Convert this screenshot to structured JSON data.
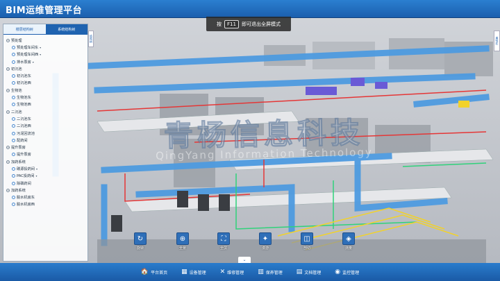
{
  "header": {
    "title": "BIM运维管理平台"
  },
  "hint": {
    "prefix": "按",
    "key": "F11",
    "suffix": "即可退出全屏模式"
  },
  "left_panel": {
    "tabs": [
      {
        "label": "楼层结构树",
        "active": false
      },
      {
        "label": "系统结构树",
        "active": true
      }
    ],
    "tree": [
      {
        "label": "预处理",
        "level": 0
      },
      {
        "label": "预处理车间东",
        "level": 1,
        "has_caret": true
      },
      {
        "label": "预处理车间西",
        "level": 1,
        "has_caret": true
      },
      {
        "label": "排水泵房",
        "level": 1,
        "has_caret": true
      },
      {
        "label": "初沉池",
        "level": 0
      },
      {
        "label": "初沉池东",
        "level": 1,
        "has_caret": false
      },
      {
        "label": "初沉池西",
        "level": 1,
        "has_caret": false
      },
      {
        "label": "生物池",
        "level": 0
      },
      {
        "label": "生物池东",
        "level": 1,
        "has_caret": false
      },
      {
        "label": "生物池西",
        "level": 1,
        "has_caret": false
      },
      {
        "label": "二沉池",
        "level": 0
      },
      {
        "label": "二沉池东",
        "level": 1,
        "has_caret": false
      },
      {
        "label": "二沉池西",
        "level": 1,
        "has_caret": false
      },
      {
        "label": "污泥回流池",
        "level": 1,
        "has_caret": false
      },
      {
        "label": "配药间",
        "level": 1,
        "has_caret": false
      },
      {
        "label": "提升泵房",
        "level": 0
      },
      {
        "label": "提升泵房",
        "level": 1,
        "has_caret": false
      },
      {
        "label": "加药系统",
        "level": 0
      },
      {
        "label": "碳源投药间",
        "level": 1,
        "has_caret": true
      },
      {
        "label": "PAC投药间",
        "level": 1,
        "has_caret": true
      },
      {
        "label": "除磷药间",
        "level": 1,
        "has_caret": false
      },
      {
        "label": "加药系统",
        "level": 0
      },
      {
        "label": "脱水机房东",
        "level": 1,
        "has_caret": false
      },
      {
        "label": "脱水机房西",
        "level": 1,
        "has_caret": false
      }
    ],
    "handle_label": "结构树"
  },
  "right_handle_label": "属性栏",
  "watermark": {
    "cn": "青杨信息科技",
    "en": "QingYang Information Technology"
  },
  "tools": [
    {
      "label": "旋转",
      "icon": "↻"
    },
    {
      "label": "全景",
      "icon": "⊕"
    },
    {
      "label": "全屏",
      "icon": "⛶"
    },
    {
      "label": "漫游",
      "icon": "✦"
    },
    {
      "label": "剖切",
      "icon": "◫"
    },
    {
      "label": "测量",
      "icon": "◈"
    }
  ],
  "collapse_icon": "chevron-down-icon",
  "nav": [
    {
      "label": "平台首页",
      "icon": "🏠"
    },
    {
      "label": "设备管理",
      "icon": "▦"
    },
    {
      "label": "维修管理",
      "icon": "✕"
    },
    {
      "label": "保养管理",
      "icon": "▥"
    },
    {
      "label": "文档管理",
      "icon": "▤"
    },
    {
      "label": "监控管理",
      "icon": "◉"
    }
  ],
  "colors": {
    "accent": "#1f63b0",
    "header": "#2b7fd0"
  }
}
